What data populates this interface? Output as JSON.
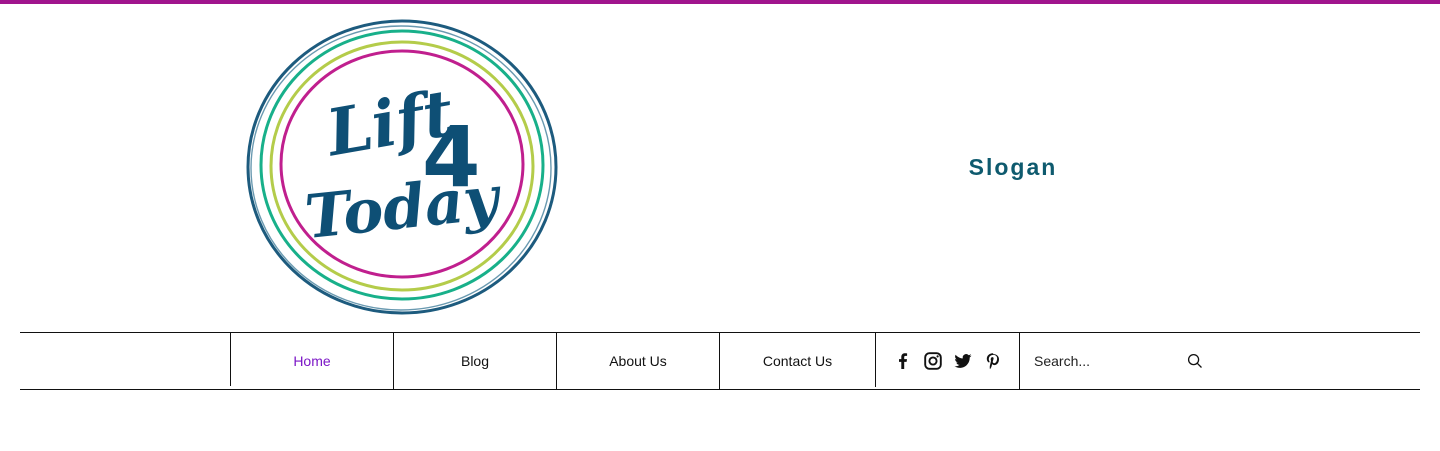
{
  "brand": {
    "logo_line1": "Lift",
    "logo_number": "4",
    "logo_line2": "Today",
    "slogan": "Slogan",
    "accent_color": "#a0158d",
    "slogan_color": "#0e5a6e"
  },
  "nav": {
    "items": [
      {
        "label": "Home",
        "active": true
      },
      {
        "label": "Blog",
        "active": false
      },
      {
        "label": "About Us",
        "active": false
      },
      {
        "label": "Contact Us",
        "active": false
      }
    ],
    "active_color": "#7b16c6"
  },
  "social": {
    "icons": [
      "facebook-icon",
      "instagram-icon",
      "twitter-icon",
      "pinterest-icon"
    ]
  },
  "search": {
    "placeholder": "Search...",
    "value": ""
  }
}
